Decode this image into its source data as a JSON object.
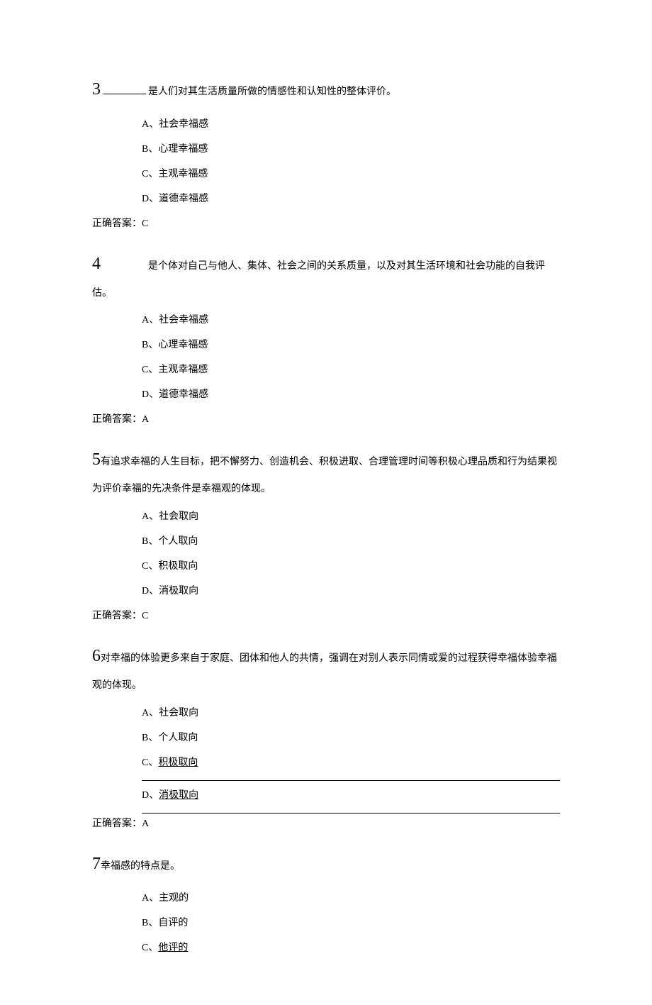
{
  "answer_label_prefix": "正确答案：",
  "questions": [
    {
      "number": "3",
      "stem_before_blank": true,
      "stem": "是人们对其生活质量所做的情感性和认知性的整体评价。",
      "options": [
        {
          "label": "A、",
          "text": "社会幸福感"
        },
        {
          "label": "B、",
          "text": "心理幸福感"
        },
        {
          "label": "C、",
          "text": "主观幸福感"
        },
        {
          "label": "D、",
          "text": "道德幸福感"
        }
      ],
      "answer": "C"
    },
    {
      "number": "4",
      "stem_before_blank": false,
      "stem": "是个体对自己与他人、集体、社会之间的关系质量，以及对其生活环境和社会功能的自我评估。",
      "options": [
        {
          "label": "A、",
          "text": "社会幸福感"
        },
        {
          "label": "B、",
          "text": "心理幸福感"
        },
        {
          "label": "C、",
          "text": "主观幸福感"
        },
        {
          "label": "D、",
          "text": "道德幸福感"
        }
      ],
      "answer": "A"
    },
    {
      "number": "5",
      "stem": "有追求幸福的人生目标，把不懈努力、创造机会、积极进取、合理管理时间等积极心理品质和行为结果视为评价幸福的先决条件是幸福观的体现。",
      "options": [
        {
          "label": "A、",
          "text": "社会取向"
        },
        {
          "label": "B、",
          "text": "个人取向"
        },
        {
          "label": "C、",
          "text": "积极取向"
        },
        {
          "label": "D、",
          "text": "消极取向"
        }
      ],
      "answer": "C"
    },
    {
      "number": "6",
      "stem": "对幸福的体验更多来自于家庭、团体和他人的共情，强调在对别人表示同情或爱的过程获得幸福体验幸福观的体现。",
      "options": [
        {
          "label": "A、",
          "text": "社会取向"
        },
        {
          "label": "B、",
          "text": "个人取向"
        },
        {
          "label": "C、",
          "text": "积极取向",
          "underline": true,
          "hr_after": true
        },
        {
          "label": "D、",
          "text": "消极取向",
          "underline": true,
          "hr_after": true
        }
      ],
      "answer": "A"
    },
    {
      "number": "7",
      "stem": "幸福感的特点是。",
      "options": [
        {
          "label": "A、",
          "text": "主观的"
        },
        {
          "label": "B、",
          "text": "自评的"
        },
        {
          "label": "C、",
          "text": "他评的",
          "underline": true
        }
      ]
    }
  ]
}
